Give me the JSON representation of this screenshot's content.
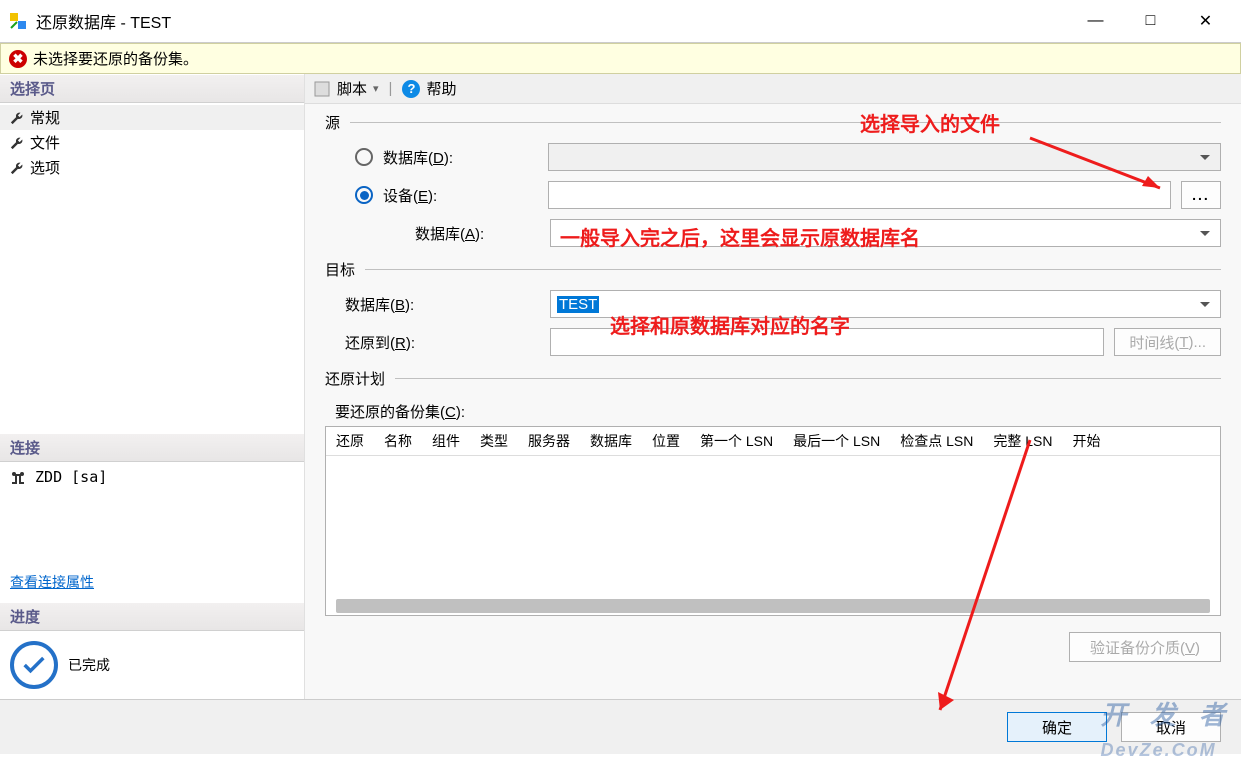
{
  "window": {
    "title": "还原数据库 - TEST",
    "minimize": "—",
    "maximize": "□",
    "close": "✕"
  },
  "errorbar": {
    "message": "未选择要还原的备份集。"
  },
  "sidebar": {
    "select_page": "选择页",
    "items": [
      {
        "label": "常规"
      },
      {
        "label": "文件"
      },
      {
        "label": "选项"
      }
    ],
    "connection_header": "连接",
    "connection_value": "ZDD [sa]",
    "connection_link": "查看连接属性",
    "progress_header": "进度",
    "progress_status": "已完成"
  },
  "toolbar": {
    "script": "脚本",
    "dropdown": "▾",
    "help": "帮助"
  },
  "form": {
    "source_header": "源",
    "radio_database": "数据库(D):",
    "radio_device": "设备(E):",
    "database_a": "数据库(A):",
    "ellipsis": "...",
    "target_header": "目标",
    "target_database": "数据库(B):",
    "target_value": "TEST",
    "restore_to": "还原到(R):",
    "timeline_btn": "时间线(T)...",
    "restore_plan_header": "还原计划",
    "backup_sets_label": "要还原的备份集(C):",
    "verify_btn": "验证备份介质(V)"
  },
  "grid": {
    "cols": [
      "还原",
      "名称",
      "组件",
      "类型",
      "服务器",
      "数据库",
      "位置",
      "第一个 LSN",
      "最后一个 LSN",
      "检查点 LSN",
      "完整 LSN",
      "开始"
    ]
  },
  "footer": {
    "ok": "确定",
    "cancel": "取消"
  },
  "watermark": "DevZe.CoM",
  "annotations": {
    "a1": "选择导入的文件",
    "a2": "一般导入完之后，这里会显示原数据库名",
    "a3": "选择和原数据库对应的名字"
  }
}
